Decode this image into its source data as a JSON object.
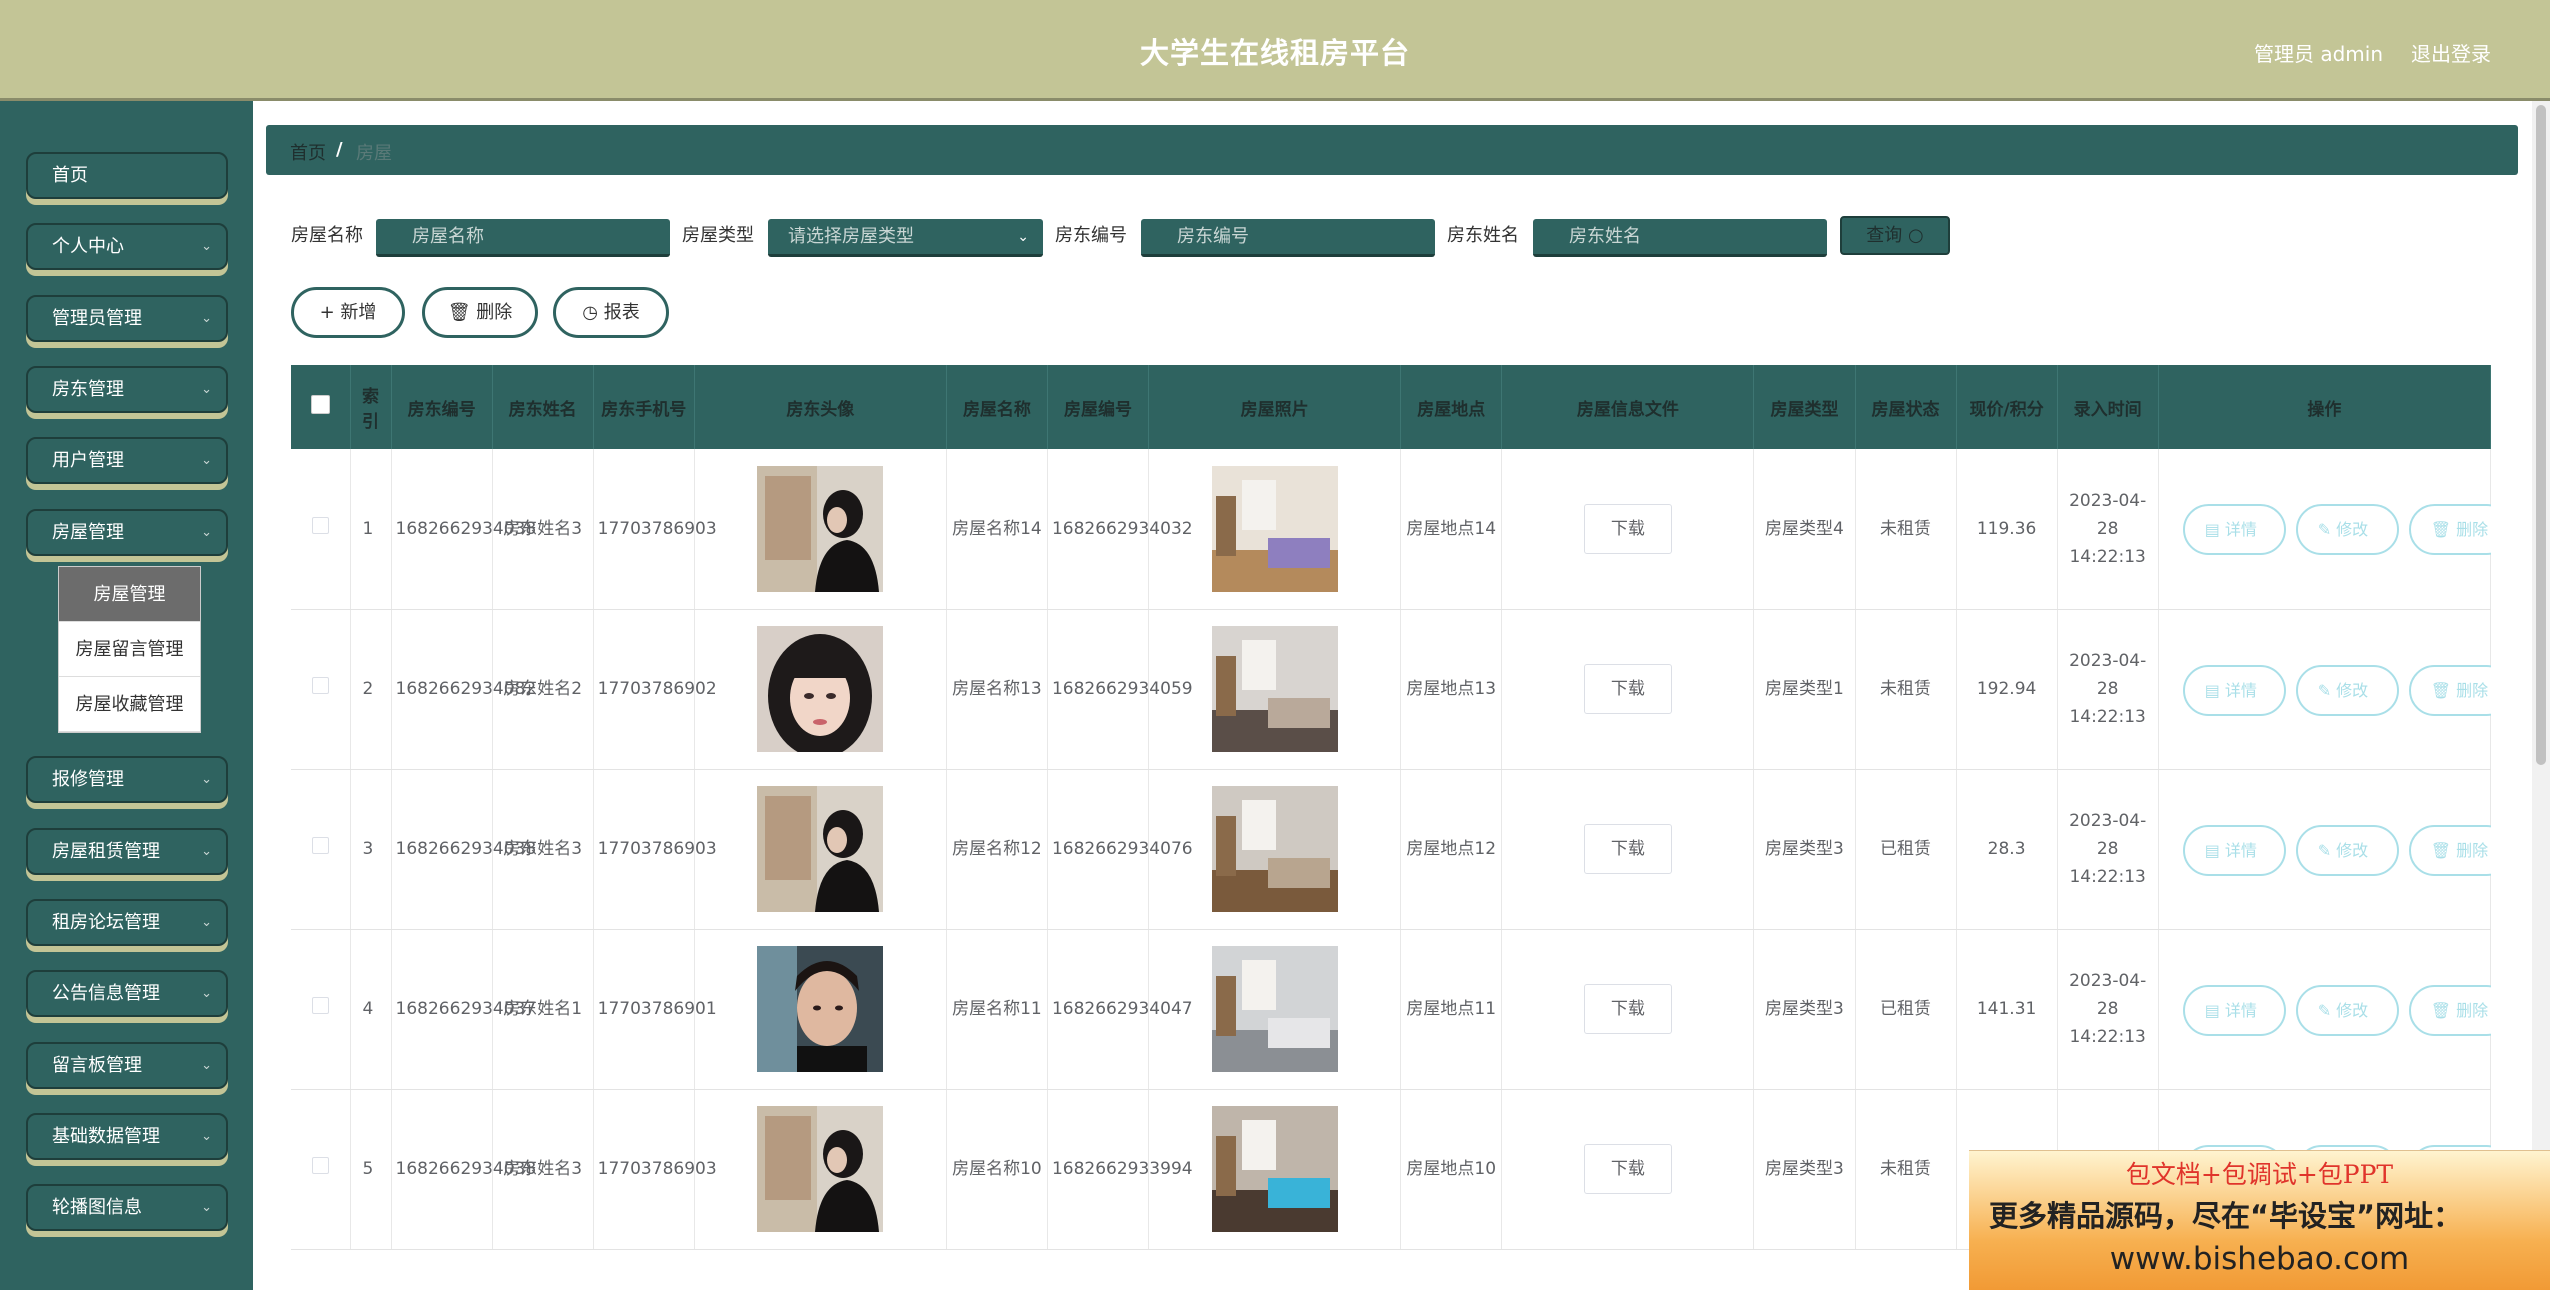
{
  "header": {
    "title": "大学生在线租房平台",
    "user": "管理员 admin",
    "logout": "退出登录"
  },
  "sidebar": {
    "items": [
      {
        "label": "首页",
        "chev": ""
      },
      {
        "label": "个人中心",
        "chev": "⌄"
      },
      {
        "label": "管理员管理",
        "chev": "⌄"
      },
      {
        "label": "房东管理",
        "chev": "⌄"
      },
      {
        "label": "用户管理",
        "chev": "⌄"
      },
      {
        "label": "房屋管理",
        "chev": "⌄"
      },
      {
        "label": "报修管理",
        "chev": "⌄"
      },
      {
        "label": "房屋租赁管理",
        "chev": "⌄"
      },
      {
        "label": "租房论坛管理",
        "chev": "⌄"
      },
      {
        "label": "公告信息管理",
        "chev": "⌄"
      },
      {
        "label": "留言板管理",
        "chev": "⌄"
      },
      {
        "label": "基础数据管理",
        "chev": "⌄"
      },
      {
        "label": "轮播图信息",
        "chev": "⌄"
      }
    ],
    "submenu": [
      "房屋管理",
      "房屋留言管理",
      "房屋收藏管理"
    ]
  },
  "breadcrumb": {
    "home": "首页",
    "sep": "/",
    "current": "房屋"
  },
  "search": {
    "name_label": "房屋名称",
    "name_placeholder": "房屋名称",
    "type_label": "房屋类型",
    "type_placeholder": "请选择房屋类型",
    "code_label": "房东编号",
    "code_placeholder": "房东编号",
    "owner_label": "房东姓名",
    "owner_placeholder": "房东姓名",
    "query_label": "查询 ○"
  },
  "actions": {
    "add": "+ 新增",
    "delete": "🗑 删除",
    "report": "◷ 报表"
  },
  "table": {
    "headers": [
      "",
      "索引",
      "房东编号",
      "房东姓名",
      "房东手机号",
      "房东头像",
      "房屋名称",
      "房屋编号",
      "房屋照片",
      "房屋地点",
      "房屋信息文件",
      "房屋类型",
      "房屋状态",
      "现价/积分",
      "录入时间",
      "操作"
    ],
    "download_label": "下载",
    "op_detail": "▤ 详情",
    "op_edit": "✎ 修改",
    "op_delete": "🗑 删除",
    "rows": [
      {
        "idx": "1",
        "owner_code": "1682662934038",
        "owner_name": "房东姓名3",
        "phone": "17703786903",
        "house_name": "房屋名称14",
        "house_code": "1682662934032",
        "location": "房屋地点14",
        "type": "房屋类型4",
        "status": "未租赁",
        "price": "119.36",
        "time": "2023-04-28 14:22:13"
      },
      {
        "idx": "2",
        "owner_code": "1682662934082",
        "owner_name": "房东姓名2",
        "phone": "17703786902",
        "house_name": "房屋名称13",
        "house_code": "1682662934059",
        "location": "房屋地点13",
        "type": "房屋类型1",
        "status": "未租赁",
        "price": "192.94",
        "time": "2023-04-28 14:22:13"
      },
      {
        "idx": "3",
        "owner_code": "1682662934038",
        "owner_name": "房东姓名3",
        "phone": "17703786903",
        "house_name": "房屋名称12",
        "house_code": "1682662934076",
        "location": "房屋地点12",
        "type": "房屋类型3",
        "status": "已租赁",
        "price": "28.3",
        "time": "2023-04-28 14:22:13"
      },
      {
        "idx": "4",
        "owner_code": "1682662934037",
        "owner_name": "房东姓名1",
        "phone": "17703786901",
        "house_name": "房屋名称11",
        "house_code": "1682662934047",
        "location": "房屋地点11",
        "type": "房屋类型3",
        "status": "已租赁",
        "price": "141.31",
        "time": "2023-04-28 14:22:13"
      },
      {
        "idx": "5",
        "owner_code": "1682662934038",
        "owner_name": "房东姓名3",
        "phone": "17703786903",
        "house_name": "房屋名称10",
        "house_code": "1682662933994",
        "location": "房屋地点10",
        "type": "房屋类型3",
        "status": "未租赁",
        "price": "",
        "time": "2023-04"
      }
    ]
  },
  "watermark": {
    "line1": "包文档+包调试+包PPT",
    "line2": "更多精品源码，尽在“毕设宝”网址：",
    "line3": "www.bishebao.com"
  }
}
